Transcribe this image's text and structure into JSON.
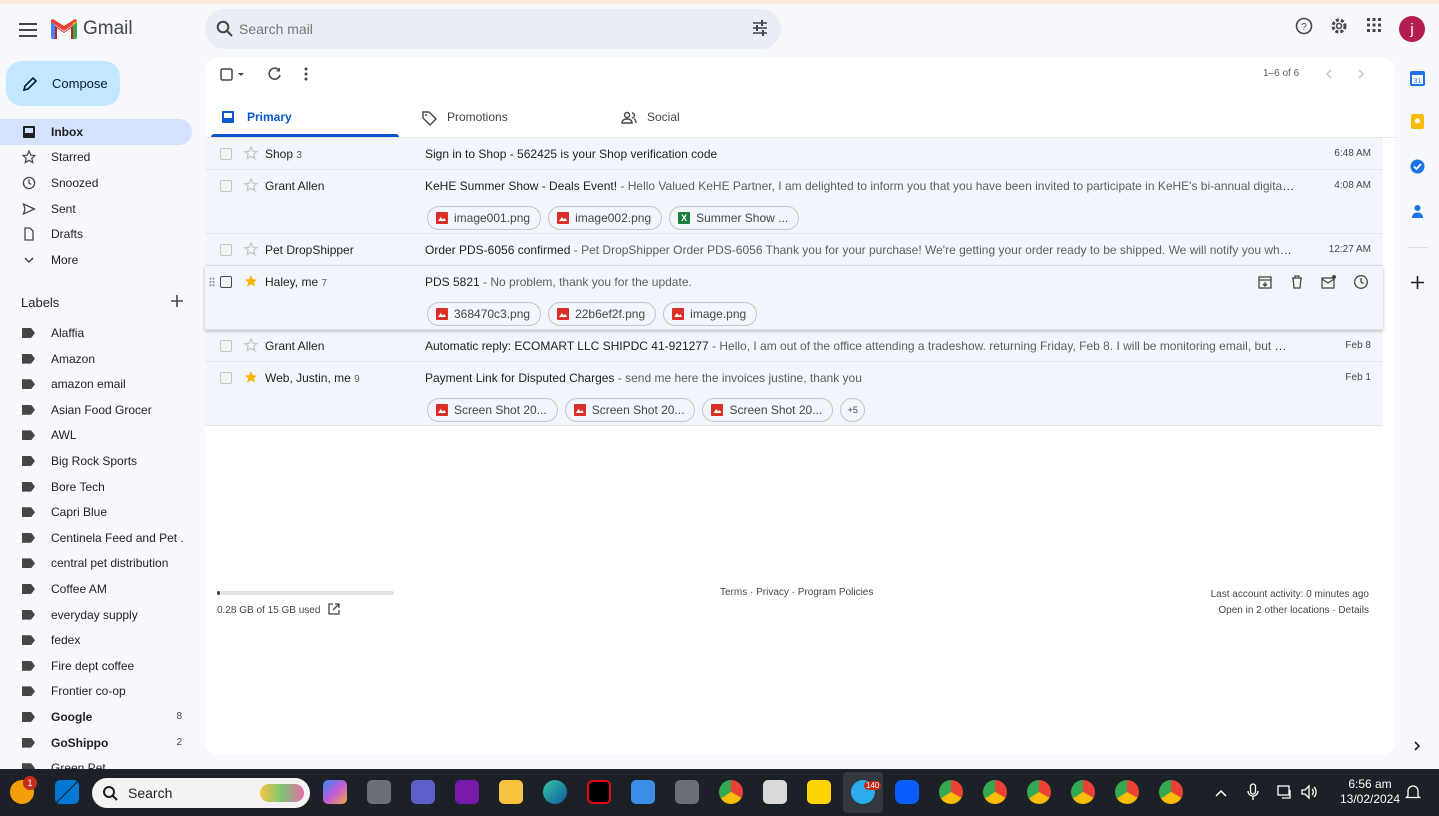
{
  "app": {
    "name": "Gmail"
  },
  "search": {
    "placeholder": "Search mail"
  },
  "user": {
    "initial": "j"
  },
  "compose": {
    "label": "Compose"
  },
  "nav": [
    {
      "label": "Inbox",
      "icon": "inbox-icon"
    },
    {
      "label": "Starred",
      "icon": "star-icon"
    },
    {
      "label": "Snoozed",
      "icon": "clock-icon"
    },
    {
      "label": "Sent",
      "icon": "send-icon"
    },
    {
      "label": "Drafts",
      "icon": "draft-icon"
    },
    {
      "label": "More",
      "icon": "chevron-down-icon"
    }
  ],
  "labels_title": "Labels",
  "labels": [
    {
      "name": "Alaffia",
      "count": "",
      "bold": false
    },
    {
      "name": "Amazon",
      "count": "",
      "bold": false
    },
    {
      "name": "amazon email",
      "count": "",
      "bold": false
    },
    {
      "name": "Asian Food Grocer",
      "count": "",
      "bold": false
    },
    {
      "name": "AWL",
      "count": "",
      "bold": false
    },
    {
      "name": "Big Rock Sports",
      "count": "",
      "bold": false
    },
    {
      "name": "Bore Tech",
      "count": "",
      "bold": false
    },
    {
      "name": "Capri Blue",
      "count": "",
      "bold": false
    },
    {
      "name": "Centinela Feed and Pet ...",
      "count": "",
      "bold": false
    },
    {
      "name": "central pet distribution",
      "count": "",
      "bold": false
    },
    {
      "name": "Coffee AM",
      "count": "",
      "bold": false
    },
    {
      "name": "everyday supply",
      "count": "",
      "bold": false
    },
    {
      "name": "fedex",
      "count": "",
      "bold": false
    },
    {
      "name": "Fire dept coffee",
      "count": "",
      "bold": false
    },
    {
      "name": "Frontier co-op",
      "count": "",
      "bold": false
    },
    {
      "name": "Google",
      "count": "8",
      "bold": true
    },
    {
      "name": "GoShippo",
      "count": "2",
      "bold": true
    },
    {
      "name": "Green Pet",
      "count": "",
      "bold": false
    }
  ],
  "toolbar": {
    "page_count": "1–6 of 6"
  },
  "tabs": [
    {
      "label": "Primary",
      "icon": "inbox-tab-icon",
      "selected": true
    },
    {
      "label": "Promotions",
      "icon": "tag-icon",
      "selected": false
    },
    {
      "label": "Social",
      "icon": "people-icon",
      "selected": false
    }
  ],
  "emails": [
    {
      "sender": "Shop",
      "count": "3",
      "subject": "Sign in to Shop - 562425 is your Shop verification code",
      "snippet": "",
      "date": "6:48 AM",
      "starred": false,
      "attachments": []
    },
    {
      "sender": "Grant Allen",
      "count": "",
      "subject": "KeHE Summer Show - Deals Event!",
      "snippet": " - Hello Valued KeHE Partner, I am delighted to inform you that you have been invited to participate in KeHE's bi-annual digital buying s...",
      "date": "4:08 AM",
      "starred": false,
      "attachments": [
        {
          "name": "image001.png",
          "type": "image"
        },
        {
          "name": "image002.png",
          "type": "image"
        },
        {
          "name": "Summer Show ...",
          "type": "sheet"
        }
      ]
    },
    {
      "sender": "Pet DropShipper",
      "count": "",
      "subject": "Order PDS-6056 confirmed",
      "snippet": " - Pet DropShipper Order PDS-6056 Thank you for your purchase! We're getting your order ready to be shipped. We will notify you when it has ...",
      "date": "12:27 AM",
      "starred": false,
      "attachments": []
    },
    {
      "sender": "Haley, me",
      "count": "7",
      "subject": "PDS 5821",
      "snippet": " - No problem, thank you for the update.",
      "date": "",
      "starred": true,
      "attachments": [
        {
          "name": "368470c3.png",
          "type": "image"
        },
        {
          "name": "22b6ef2f.png",
          "type": "image"
        },
        {
          "name": "image.png",
          "type": "image"
        }
      ]
    },
    {
      "sender": "Grant Allen",
      "count": "",
      "subject": "Automatic reply: ECOMART LLC SHIPDC 41-921277",
      "snippet": " - Hello, I am out of the office attending a tradeshow. returning Friday, Feb 8. I will be monitoring email, but my response...",
      "date": "Feb 8",
      "starred": false,
      "attachments": []
    },
    {
      "sender": "Web, Justin, me",
      "count": "9",
      "subject": "Payment Link for Disputed Charges",
      "snippet": " - send me here the invoices justine, thank you",
      "date": "Feb 1",
      "starred": true,
      "attachments": [
        {
          "name": "Screen Shot 20...",
          "type": "image"
        },
        {
          "name": "Screen Shot 20...",
          "type": "image"
        },
        {
          "name": "Screen Shot 20...",
          "type": "image"
        }
      ],
      "more_attachments": "+5"
    }
  ],
  "footer": {
    "storage": "0.28 GB of 15 GB used",
    "storage_fraction": 0.019,
    "links": "Terms · Privacy · Program Policies",
    "activity": "Last account activity: 0 minutes ago",
    "locations": "Open in 2 other locations · Details"
  },
  "taskbar": {
    "search": "Search",
    "time": "6:56 am",
    "date": "13/02/2024",
    "badge": "1",
    "telegram_badge": "140"
  },
  "colors": {
    "accent": "#0b57d0",
    "compose": "#c2e7ff",
    "star": "#f4b400",
    "attachment": "#d93025"
  }
}
